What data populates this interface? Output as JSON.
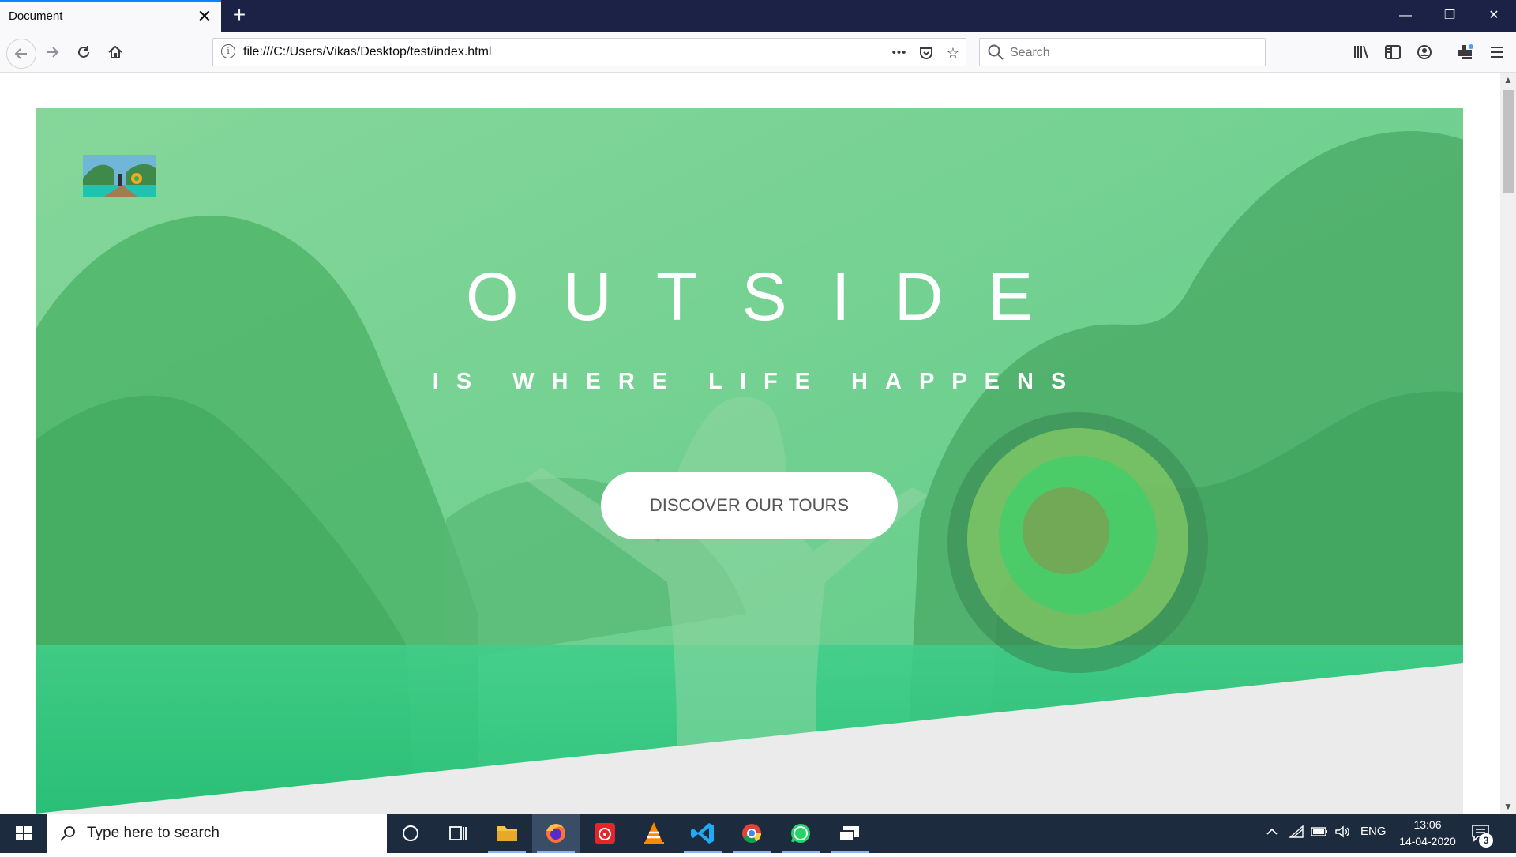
{
  "browser": {
    "tab_title": "Document",
    "tab_close": "✕",
    "new_tab": "+",
    "url": "file:///C:/Users/Vikas/Desktop/test/index.html",
    "page_actions": "•••",
    "search_placeholder": "Search",
    "window_controls": {
      "minimize": "—",
      "restore": "❐",
      "close": "✕"
    }
  },
  "hero": {
    "title": "OUTSIDE",
    "subtitle": "IS WHERE LIFE HAPPENS",
    "cta_label": "DISCOVER OUR TOURS",
    "overlay_colors": [
      "#7bd393",
      "#2ebd77"
    ]
  },
  "taskbar": {
    "search_text": "Type here to search",
    "language": "ENG",
    "time": "13:06",
    "date": "14-04-2020",
    "notification_count": "3",
    "apps": [
      "cortana",
      "task-view",
      "file-explorer",
      "firefox",
      "music-player",
      "vlc",
      "vs-code",
      "chrome",
      "whatsapp",
      "desktop-app"
    ]
  }
}
